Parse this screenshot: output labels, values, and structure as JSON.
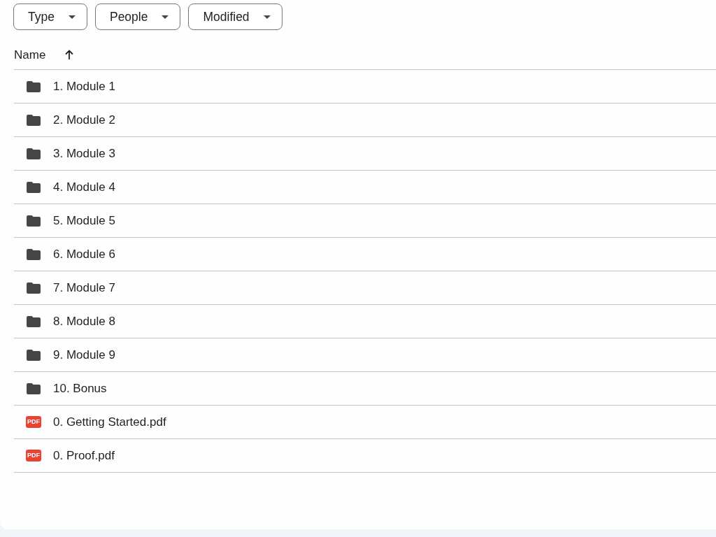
{
  "filters": [
    {
      "label": "Type"
    },
    {
      "label": "People"
    },
    {
      "label": "Modified"
    }
  ],
  "list_header": {
    "label": "Name",
    "sort_ascending": true
  },
  "items": [
    {
      "kind": "folder",
      "name": "1. Module 1"
    },
    {
      "kind": "folder",
      "name": "2. Module 2"
    },
    {
      "kind": "folder",
      "name": "3. Module 3"
    },
    {
      "kind": "folder",
      "name": "4. Module 4"
    },
    {
      "kind": "folder",
      "name": "5. Module 5"
    },
    {
      "kind": "folder",
      "name": "6. Module 6"
    },
    {
      "kind": "folder",
      "name": "7. Module 7"
    },
    {
      "kind": "folder",
      "name": "8. Module 8"
    },
    {
      "kind": "folder",
      "name": "9. Module 9"
    },
    {
      "kind": "folder",
      "name": "10. Bonus"
    },
    {
      "kind": "pdf",
      "badge": "PDF",
      "name": "0. Getting Started.pdf"
    },
    {
      "kind": "pdf",
      "badge": "PDF",
      "name": "0. Proof.pdf"
    }
  ]
}
